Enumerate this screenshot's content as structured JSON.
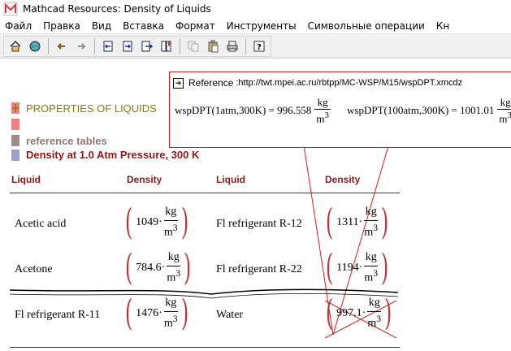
{
  "window": {
    "title": "Mathcad Resources: Density of Liquids"
  },
  "menu": [
    "Файл",
    "Правка",
    "Вид",
    "Вставка",
    "Формат",
    "Инструменты",
    "Символьные операции",
    "Кн"
  ],
  "toolbar": {
    "buttons": [
      "home-icon",
      "globe-icon",
      "back-arrow-icon",
      "forward-arrow-icon",
      "nav-first-icon",
      "nav-in-icon",
      "nav-next-icon",
      "bookmark-icon",
      "copy-icon",
      "paste-icon",
      "print-icon",
      "help-icon"
    ]
  },
  "reference": {
    "label": "Reference",
    "url": ":http://twt.mpei.ac.ru/rbtpp/MC-WSP/M15/wspDPT.xmcdz",
    "formula1": {
      "expr": "wspDPT(1atm,300K) = 996.558",
      "num": "kg",
      "den": "m"
    },
    "formula2": {
      "expr": "wspDPT(100atm,300K) = 1001.01",
      "num": "kg",
      "den": "m"
    }
  },
  "sections": {
    "properties": "PROPERTIES OF LIQUIDS",
    "reference_tables": "reference tables",
    "density_title": "Density at 1.0 Atm Pressure, 300 K"
  },
  "colors": {
    "section_red": "#8b1a1a",
    "olive": "#8b7d00",
    "pink": "#f08080",
    "taupe": "#a08c8c",
    "lavender": "#a0a0d0"
  },
  "table": {
    "headers": [
      "Liquid",
      "Density",
      "Liquid",
      "Density"
    ],
    "unit_num": "kg",
    "unit_den": "m",
    "unit_exp": "3",
    "rows": [
      [
        {
          "name": "Acetic acid",
          "value": "1049·"
        },
        {
          "name": "Fl refrigerant R-12",
          "value": "1311·"
        }
      ],
      [
        {
          "name": "Acetone",
          "value": "784.6·"
        },
        {
          "name": "Fl refrigerant R-22",
          "value": "1194·"
        }
      ],
      [
        {
          "name": "Fl refrigerant R-11",
          "value": "1476·"
        },
        {
          "name": "Water",
          "value": "997.1·"
        }
      ]
    ]
  }
}
